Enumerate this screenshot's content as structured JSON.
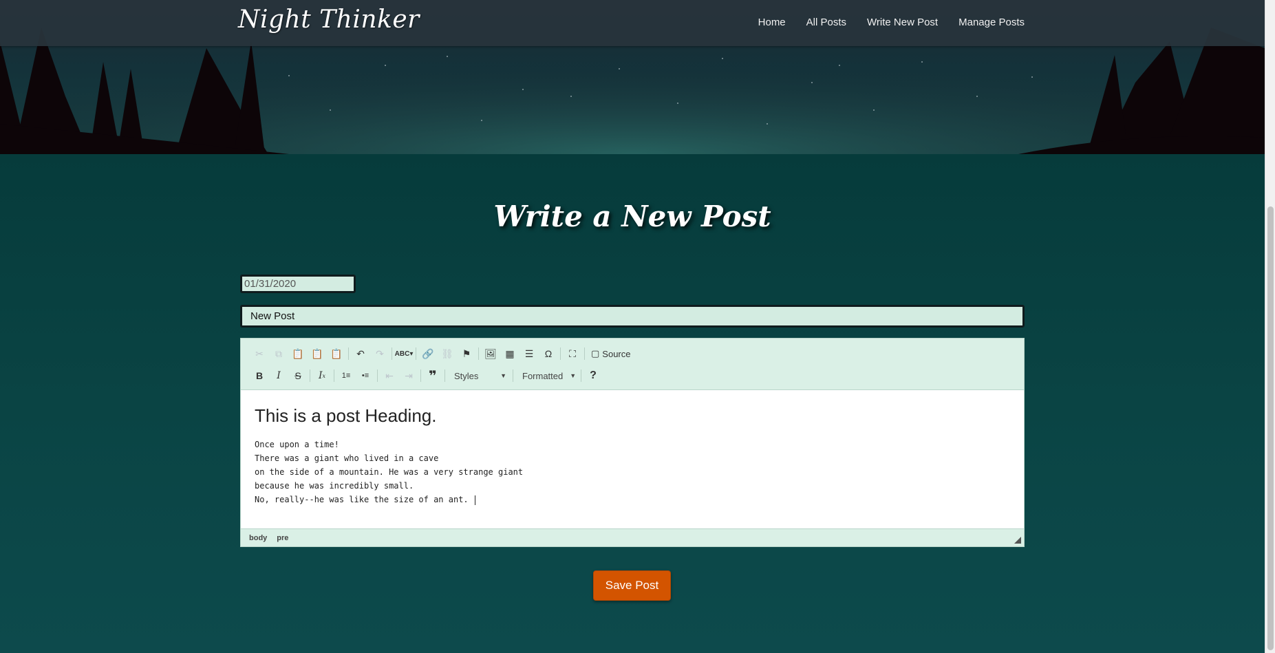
{
  "brand": "Night Thinker",
  "nav": {
    "home": "Home",
    "all_posts": "All Posts",
    "write_new_post": "Write New Post",
    "manage_posts": "Manage Posts"
  },
  "page_title": "Write a New Post",
  "form": {
    "date_value": "01/31/2020",
    "title_value": "New Post"
  },
  "editor": {
    "toolbar": {
      "source_label": "Source",
      "styles_label": "Styles",
      "format_label": "Formatted"
    },
    "heading": "This is a post Heading.",
    "body_lines": [
      "Once upon a time!",
      "There was a giant who lived in a cave",
      "on the side of a mountain. He was a very strange giant",
      "because he was incredibly small.",
      "No, really--he was like the size of an ant. "
    ],
    "path": [
      "body",
      "pre"
    ]
  },
  "save_label": "Save Post",
  "colors": {
    "accent": "#d35400",
    "page_bg": "#0a3d3e",
    "input_bg": "#d3ece1",
    "toolbar_bg": "#daf0e6"
  }
}
